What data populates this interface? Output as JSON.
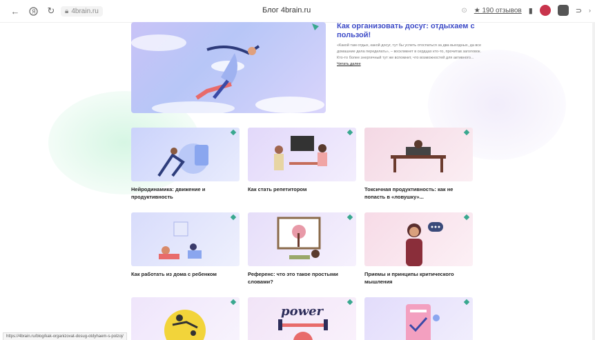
{
  "browser": {
    "url": "4brain.ru",
    "page_title": "Блог 4brain.ru",
    "reviews_label": "★ 190 отзывов",
    "status_url": "https://4brain.ru/blog/kak-organizovat-dosug-otdyhaem-s-polzoj/"
  },
  "hero": {
    "title": "Как организовать досуг: отдыхаем с пользой!",
    "description": "«Какой там отдых, какой досуг, тут бы успеть отоспаться за два выходных, да все домашние дела переделать», – воскликнет в сердцах кто-то, прочитав заголовок. Кто-то более энергичный тут же вспомнит, что возможностей для активного...",
    "more_label": "Читать далее"
  },
  "cards": [
    {
      "title": "Нейродинамика: движение и продуктивность",
      "bg": "#d7dcfb"
    },
    {
      "title": "Как стать репетитором",
      "bg": "#e6defa"
    },
    {
      "title": "Токсичная продуктивность: как не попасть в «ловушку»...",
      "bg": "#f5dde6"
    },
    {
      "title": "Как работать из дома с ребенком",
      "bg": "#dfe2fb"
    },
    {
      "title": "Референс: что это такое простыми словами?",
      "bg": "#e9e3fb"
    },
    {
      "title": "Приемы и принципы критического мышления",
      "bg": "#f8e2ec"
    },
    {
      "title": "",
      "bg": "#efe8fb"
    },
    {
      "title": "",
      "bg": "#f2e6f7"
    },
    {
      "title": "",
      "bg": "#e4defb"
    }
  ],
  "power_word": "power"
}
